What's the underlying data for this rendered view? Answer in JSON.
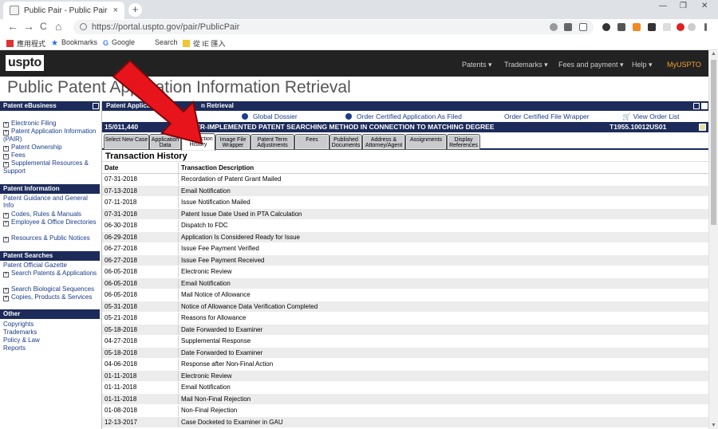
{
  "browser": {
    "tab_title": "Public Pair - Public Pair",
    "tab_close": "×",
    "new_tab": "+",
    "win_min": "—",
    "win_max": "❐",
    "win_close": "✕",
    "url": "https://portal.uspto.gov/pair/PublicPair",
    "back": "←",
    "forward": "→",
    "reload": "C",
    "home": "⌂",
    "bookmarks": [
      {
        "label": "應用程式"
      },
      {
        "label": "Bookmarks"
      },
      {
        "label": "Google"
      },
      {
        "label": "Search"
      },
      {
        "label": "從 IE 匯入"
      }
    ]
  },
  "navbar": {
    "logo": "uspto",
    "items": [
      "Patents ▾",
      "Trademarks ▾",
      "Fees and payment ▾",
      "Help ▾"
    ],
    "my": "MyUSPTO"
  },
  "app_title": "Public Patent Application Information Retrieval",
  "sidebar": {
    "sections": [
      {
        "title": "Patent eBusiness",
        "items": [
          {
            "label": "Electronic Filing",
            "expandable": true
          },
          {
            "label": "Patent Application Information (PAIR)",
            "expandable": true
          },
          {
            "label": "Patent Ownership",
            "expandable": true
          },
          {
            "label": "Fees",
            "expandable": true
          },
          {
            "label": "Supplemental Resources & Support",
            "expandable": true
          }
        ]
      },
      {
        "title": "Patent Information",
        "items": [
          {
            "label": "Patent Guidance and General Info",
            "expandable": false
          },
          {
            "label": "Codes, Rules & Manuals",
            "expandable": true
          },
          {
            "label": "Employee & Office Directories",
            "expandable": true
          },
          {
            "label": "Resources & Public Notices",
            "expandable": true
          }
        ]
      },
      {
        "title": "Patent Searches",
        "items": [
          {
            "label": "Patent Official Gazette",
            "expandable": false
          },
          {
            "label": "Search Patents & Applications",
            "expandable": true
          },
          {
            "label": "Search Biological Sequences",
            "expandable": true
          },
          {
            "label": "Copies, Products & Services",
            "expandable": true
          }
        ]
      },
      {
        "title": "Other",
        "items": [
          {
            "label": "Copyrights",
            "expandable": false
          },
          {
            "label": "Trademarks",
            "expandable": false
          },
          {
            "label": "Policy & Law",
            "expandable": false
          },
          {
            "label": "Reports",
            "expandable": false
          }
        ]
      }
    ]
  },
  "main": {
    "header_left": "Patent Applica",
    "header_right": "n Retrieval",
    "links": {
      "global_dossier": "Global Dossier",
      "order_certified_app": "Order Certified Application As Filed",
      "order_wrapper": "Order Certified File Wrapper",
      "view_order": "View Order List"
    },
    "app_number": "15/011,440",
    "app_title": "TER-IMPLEMENTED PATENT SEARCHING METHOD IN CONNECTION TO MATCHING DEGREE",
    "docket": "T1955.10012US01",
    "tabs": [
      {
        "label": "Select New Case",
        "active": false
      },
      {
        "label": "Application Data",
        "active": false
      },
      {
        "label": "Transaction History",
        "active": true
      },
      {
        "label": "Image File Wrapper",
        "active": false
      },
      {
        "label": "Patent Term Adjustments",
        "active": false
      },
      {
        "label": "Fees",
        "active": false
      },
      {
        "label": "Published Documents",
        "active": false
      },
      {
        "label": "Address & Attorney/Agent",
        "active": false
      },
      {
        "label": "Assignments",
        "active": false
      },
      {
        "label": "Display References",
        "active": false
      }
    ],
    "section_title": "Transaction History",
    "columns": [
      "Date",
      "Transaction Description"
    ],
    "rows": [
      [
        "07-31-2018",
        "Recordation of Patent Grant Mailed"
      ],
      [
        "07-13-2018",
        "Email Notification"
      ],
      [
        "07-11-2018",
        "Issue Notification Mailed"
      ],
      [
        "07-31-2018",
        "Patent Issue Date Used in PTA Calculation"
      ],
      [
        "06-30-2018",
        "Dispatch to FDC"
      ],
      [
        "06-29-2018",
        "Application Is Considered Ready for Issue"
      ],
      [
        "06-27-2018",
        "Issue Fee Payment Verified"
      ],
      [
        "06-27-2018",
        "Issue Fee Payment Received"
      ],
      [
        "06-05-2018",
        "Electronic Review"
      ],
      [
        "06-05-2018",
        "Email Notification"
      ],
      [
        "06-05-2018",
        "Mail Notice of Allowance"
      ],
      [
        "05-31-2018",
        "Notice of Allowance Data Verification Completed"
      ],
      [
        "05-21-2018",
        "Reasons for Allowance"
      ],
      [
        "05-18-2018",
        "Date Forwarded to Examiner"
      ],
      [
        "04-27-2018",
        "Supplemental Response"
      ],
      [
        "05-18-2018",
        "Date Forwarded to Examiner"
      ],
      [
        "04-06-2018",
        "Response after Non-Final Action"
      ],
      [
        "01-11-2018",
        "Electronic Review"
      ],
      [
        "01-11-2018",
        "Email Notification"
      ],
      [
        "01-11-2018",
        "Mail Non-Final Rejection"
      ],
      [
        "01-08-2018",
        "Non-Final Rejection"
      ],
      [
        "12-13-2017",
        "Case Docketed to Examiner in GAU"
      ]
    ]
  },
  "colors": {
    "navy": "#1c2b5a",
    "link": "#1a3c8a",
    "arrow": "#e8141c",
    "my_uspto": "#f0a030"
  }
}
